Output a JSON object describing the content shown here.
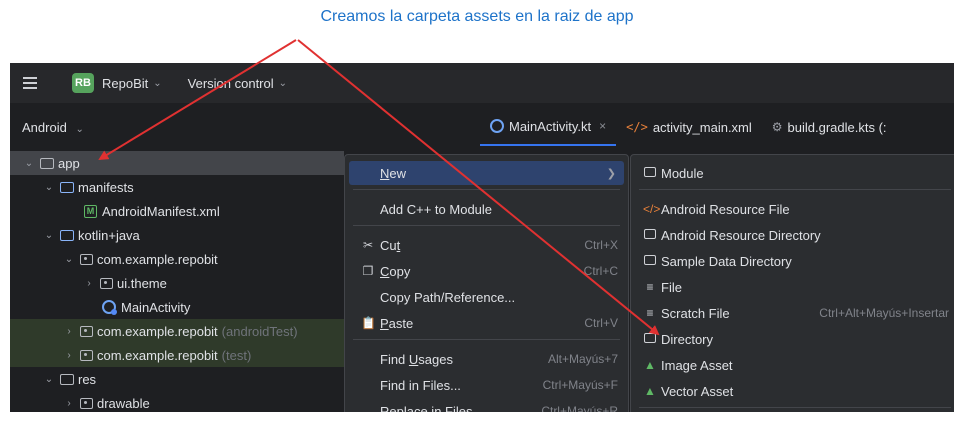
{
  "caption": "Creamos la carpeta assets en la raiz de app",
  "toolbar": {
    "project_badge": "RB",
    "project_name": "RepoBit",
    "vcs_label": "Version control"
  },
  "project_panel": {
    "view_label": "Android",
    "tree": [
      {
        "label": "app"
      },
      {
        "label": "manifests"
      },
      {
        "label": "AndroidManifest.xml"
      },
      {
        "label": "kotlin+java"
      },
      {
        "label": "com.example.repobit"
      },
      {
        "label": "ui.theme"
      },
      {
        "label": "MainActivity"
      },
      {
        "label": "com.example.repobit",
        "suffix": "(androidTest)"
      },
      {
        "label": "com.example.repobit",
        "suffix": "(test)"
      },
      {
        "label": "res"
      },
      {
        "label": "drawable"
      }
    ]
  },
  "editor_tabs": [
    {
      "label": "MainActivity.kt",
      "close": "×"
    },
    {
      "label": "activity_main.xml"
    },
    {
      "label": "build.gradle.kts (:"
    }
  ],
  "context_menu": [
    {
      "label": "New",
      "underline": "N",
      "rest": "ew"
    },
    {
      "label": "Add C++ to Module"
    },
    {
      "label": "Cut",
      "pre": "Cu",
      "underline": "t",
      "shortcut": "Ctrl+X"
    },
    {
      "label": "Copy",
      "underline": "C",
      "rest": "opy",
      "shortcut": "Ctrl+C"
    },
    {
      "label": "Copy Path/Reference..."
    },
    {
      "label": "Paste",
      "underline": "P",
      "rest": "aste",
      "shortcut": "Ctrl+V"
    },
    {
      "label": "Find Usages",
      "pre": "Find ",
      "underline": "U",
      "rest": "sages",
      "shortcut": "Alt+Mayús+7"
    },
    {
      "label": "Find in Files...",
      "shortcut": "Ctrl+Mayús+F"
    },
    {
      "label": "Replace in Files",
      "shortcut": "Ctrl+Mayús+R"
    }
  ],
  "submenu": [
    {
      "label": "Module"
    },
    {
      "label": "Android Resource File"
    },
    {
      "label": "Android Resource Directory"
    },
    {
      "label": "Sample Data Directory"
    },
    {
      "label": "File"
    },
    {
      "label": "Scratch File",
      "shortcut": "Ctrl+Alt+Mayús+Insertar"
    },
    {
      "label": "Directory"
    },
    {
      "label": "Image Asset"
    },
    {
      "label": "Vector Asset"
    }
  ],
  "colors": {
    "annotation_arrow": "#e03131",
    "caption": "#1e73c9",
    "highlight": "#2e436e",
    "ide_background": "#1e1f22"
  }
}
